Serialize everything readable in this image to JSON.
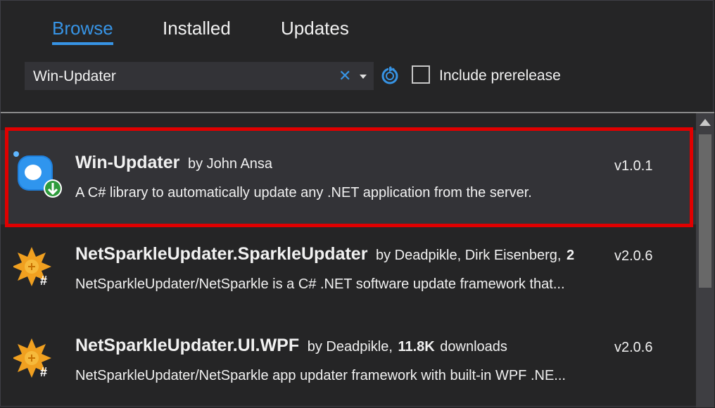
{
  "tabs": [
    {
      "label": "Browse",
      "active": true
    },
    {
      "label": "Installed",
      "active": false
    },
    {
      "label": "Updates",
      "active": false
    }
  ],
  "search": {
    "value": "Win-Updater",
    "clear_icon": "close-icon",
    "dropdown_icon": "chevron-down-icon"
  },
  "toolbar": {
    "refresh_icon": "refresh-icon",
    "include_prerelease_label": "Include prerelease",
    "include_prerelease_checked": false
  },
  "packages": [
    {
      "name": "Win-Updater",
      "by": "by John Ansa",
      "description": "A C# library to automatically update any .NET application from the server.",
      "version": "v1.0.1",
      "icon": "package-icon-blue",
      "selected": true
    },
    {
      "name": "NetSparkleUpdater.SparkleUpdater",
      "by": "by Deadpikle, Dirk Eisenberg,",
      "by_extra": "2",
      "description": "NetSparkleUpdater/NetSparkle is a C# .NET software update framework that...",
      "version": "v2.0.6",
      "icon": "sparkle-csharp-icon"
    },
    {
      "name": "NetSparkleUpdater.UI.WPF",
      "by": "by Deadpikle,",
      "downloads": "11.8K",
      "downloads_label": "downloads",
      "description": "NetSparkleUpdater/NetSparkle app updater framework with built-in WPF .NE...",
      "version": "v2.0.6",
      "icon": "sparkle-csharp-icon"
    }
  ],
  "colors": {
    "background": "#252526",
    "accent": "#3794e5",
    "highlight": "#e00000",
    "selected_row": "#333337"
  }
}
